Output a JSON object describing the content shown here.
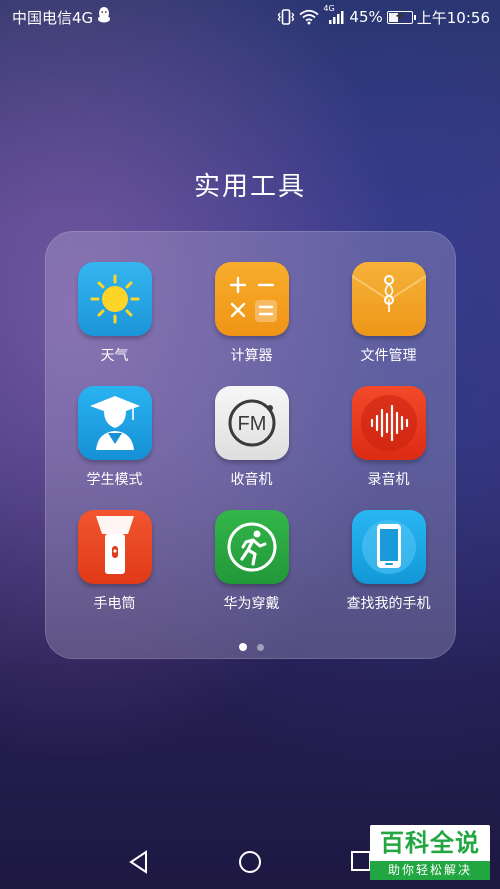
{
  "status_bar": {
    "carrier": "中国电信4G",
    "network_badge": "4G",
    "battery_percent": "45%",
    "battery_level": 0.45,
    "time": "上午10:56",
    "icons": [
      "qq-penguin-icon",
      "vibrate-icon",
      "wifi-icon",
      "signal-icon",
      "battery-charging-icon"
    ]
  },
  "folder": {
    "title": "实用工具",
    "apps": [
      {
        "label": "天气",
        "icon": "weather-sun-icon",
        "color": "#2aa6e6"
      },
      {
        "label": "计算器",
        "icon": "calculator-icon",
        "color": "#f3a020"
      },
      {
        "label": "文件管理",
        "icon": "envelope-icon",
        "color": "#f0a020"
      },
      {
        "label": "学生模式",
        "icon": "graduate-icon",
        "color": "#1ea3e6"
      },
      {
        "label": "收音机",
        "icon": "fm-radio-icon",
        "color": "#e8e8e8"
      },
      {
        "label": "录音机",
        "icon": "soundwave-icon",
        "color": "#e8331b"
      },
      {
        "label": "手电筒",
        "icon": "flashlight-icon",
        "color": "#e8401c"
      },
      {
        "label": "华为穿戴",
        "icon": "running-man-icon",
        "color": "#2aaa3f"
      },
      {
        "label": "查找我的手机",
        "icon": "phone-icon",
        "color": "#1aa9e8"
      }
    ],
    "pages": 2,
    "current_page": 1
  },
  "fm_text": "FM",
  "nav": {
    "icons": [
      "back-icon",
      "home-icon",
      "recents-icon"
    ]
  },
  "watermark": {
    "title": "百科全说",
    "subtitle": "助你轻松解决"
  }
}
